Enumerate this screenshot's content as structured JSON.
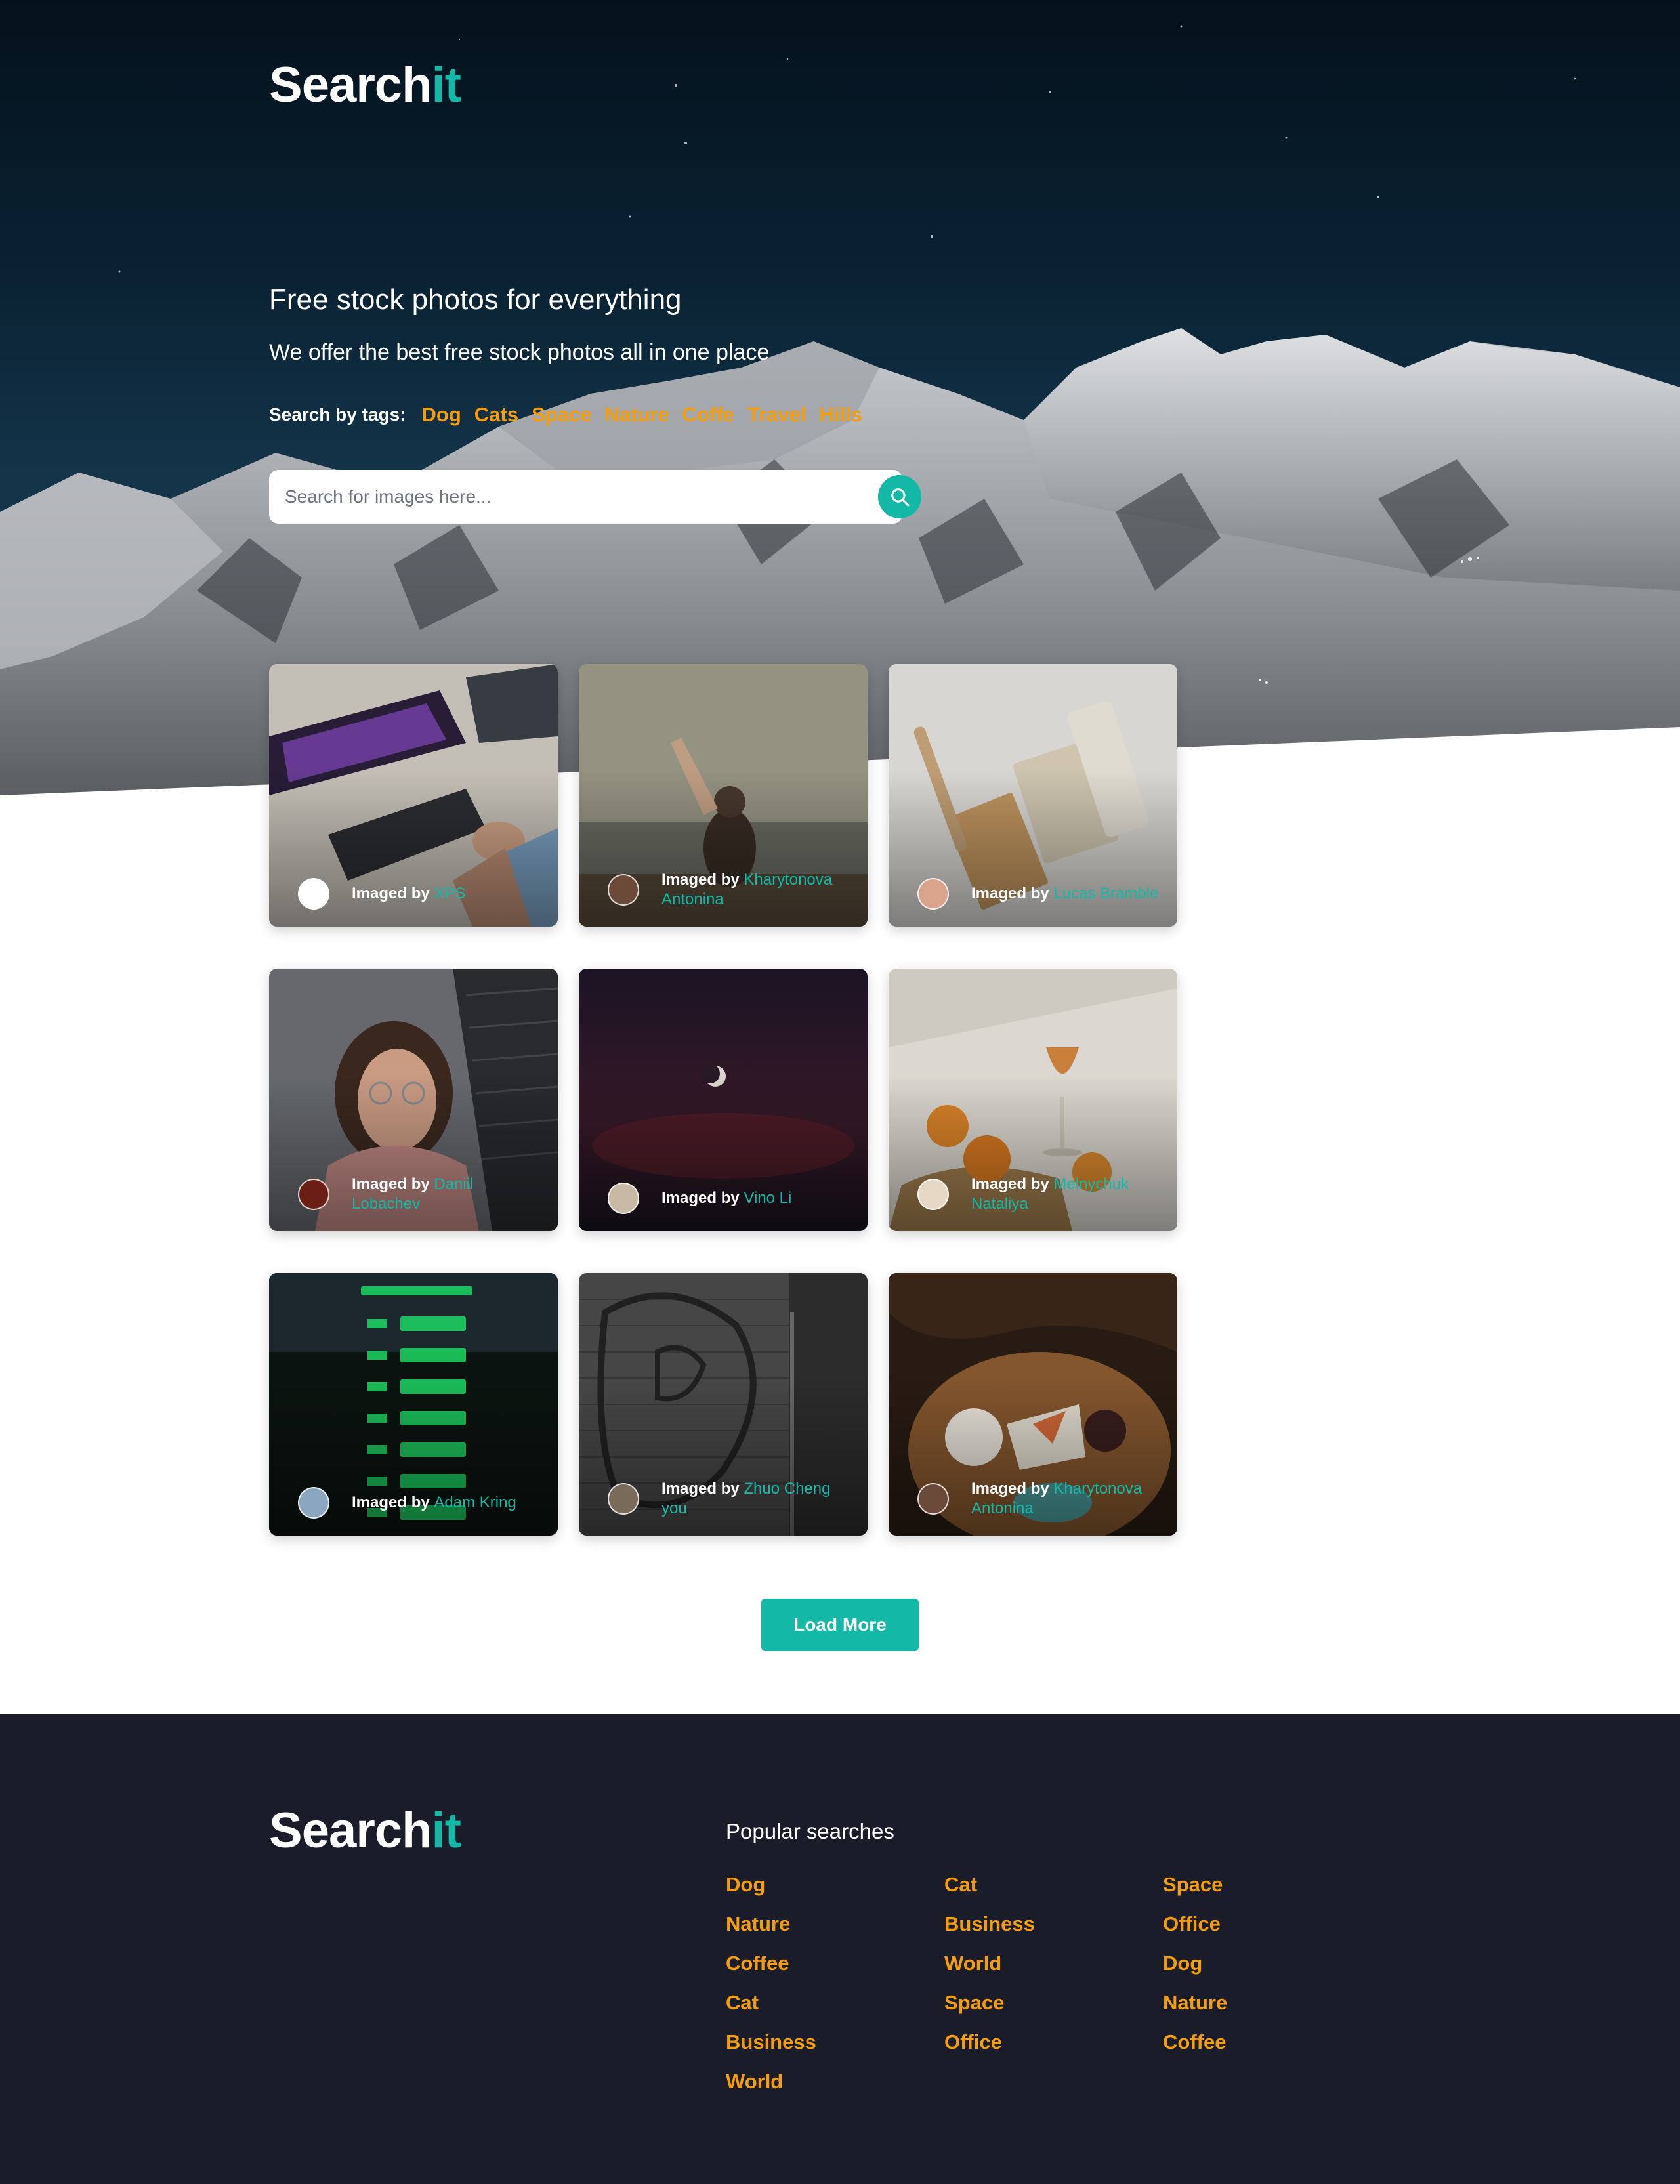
{
  "brand": {
    "name_main": "Search",
    "name_accent": "it"
  },
  "hero": {
    "headline": "Free stock photos for everything",
    "subline": "We offer the best free stock photos all in one place",
    "tags_label": "Search by tags:",
    "tags": [
      "Dog",
      "Cats",
      "Space",
      "Nature",
      "Coffe",
      "Travel",
      "Hills"
    ]
  },
  "search": {
    "placeholder": "Search for images here...",
    "button_icon": "search-icon"
  },
  "cards": [
    {
      "prefix": "Imaged by",
      "author": "XPS"
    },
    {
      "prefix": "Imaged by",
      "author": "Kharytonova Antonina"
    },
    {
      "prefix": "Imaged by",
      "author": "Lucas Bramble"
    },
    {
      "prefix": "Imaged by",
      "author": "Daniil Lobachev"
    },
    {
      "prefix": "Imaged by",
      "author": "Vino Li"
    },
    {
      "prefix": "Imaged by",
      "author": "Melnychuk Nataliya"
    },
    {
      "prefix": "Imaged by",
      "author": "Adam Kring"
    },
    {
      "prefix": "Imaged by",
      "author": "Zhuo Cheng you"
    },
    {
      "prefix": "Imaged by",
      "author": "Kharytonova Antonina"
    }
  ],
  "load_more": "Load More",
  "footer": {
    "title": "Popular searches",
    "columns": [
      [
        "Dog",
        "Nature",
        "Coffee",
        "Cat",
        "Business",
        "World"
      ],
      [
        "Cat",
        "Business",
        "World",
        "Space",
        "Office"
      ],
      [
        "Space",
        "Office",
        "Dog",
        "Nature",
        "Coffee"
      ]
    ]
  },
  "colors": {
    "accent": "#14b8a6",
    "tag": "#f59e0b",
    "footer_bg": "#1a1d29"
  }
}
